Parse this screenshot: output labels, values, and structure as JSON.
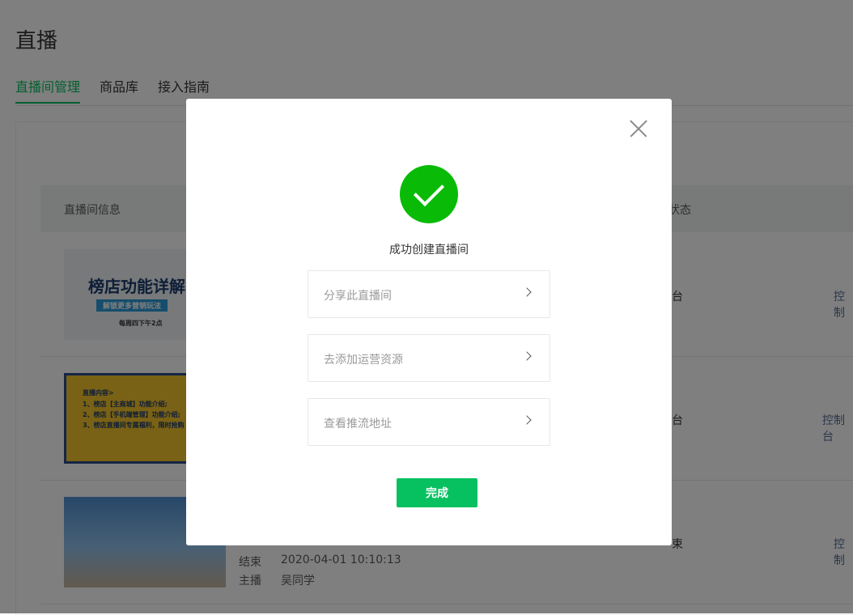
{
  "page": {
    "title": "直播"
  },
  "tabs": [
    {
      "label": "直播间管理",
      "active": true
    },
    {
      "label": "商品库"
    },
    {
      "label": "接入指南"
    }
  ],
  "table": {
    "headers": {
      "info": "直播间信息",
      "status": "状态"
    },
    "rows": [
      {
        "cover_title": "榜店功能详解",
        "cover_sub": "解锁更多营销玩法",
        "cover_time": "每周四下午2点",
        "status": "台",
        "op": "控制"
      },
      {
        "cover_lines": [
          "直播内容>",
          "1、榜店【主商城】功能介绍;",
          "2、榜店【手机端管理】功能介绍;",
          "3、榜店直播间专属福利，限时抢购"
        ],
        "status": "台",
        "op": "控制台"
      },
      {
        "end_label": "结束",
        "end_value": "2020-04-01 10:10:13",
        "host_label": "主播",
        "host_value": "吴同学",
        "status": "束",
        "op": "控制"
      }
    ]
  },
  "dialog": {
    "title": "成功创建直播间",
    "options": [
      {
        "label": "分享此直播间"
      },
      {
        "label": "去添加运营资源"
      },
      {
        "label": "查看推流地址"
      }
    ],
    "done_label": "完成",
    "success_color": "#09bb07",
    "accent_color": "#07c160"
  }
}
